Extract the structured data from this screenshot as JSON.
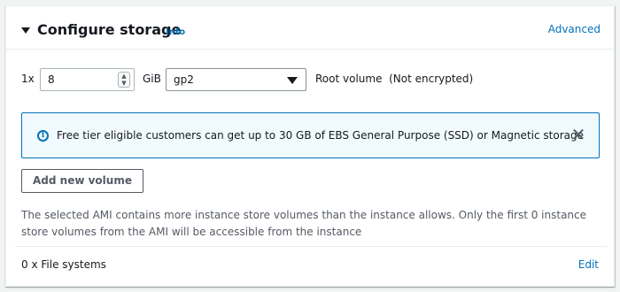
{
  "header": {
    "title": "Configure storage",
    "info_label": "Info",
    "advanced_label": "Advanced"
  },
  "volume": {
    "quantity_label": "1x",
    "size_value": "8",
    "size_unit": "GiB",
    "volume_type": "gp2",
    "root_label": "Root volume  (Not encrypted)"
  },
  "alert": {
    "icon": "info-icon",
    "text": "Free tier eligible customers can get up to 30 GB of EBS General Purpose (SSD) or Magnetic storage",
    "close_icon": "close-icon"
  },
  "actions": {
    "add_volume_label": "Add new volume"
  },
  "note": {
    "text": "The selected AMI contains more instance store volumes than the instance allows. Only the first 0 instance store volumes from the AMI will be accessible from the instance"
  },
  "file_systems": {
    "label": "0 x File systems",
    "edit_label": "Edit"
  },
  "colors": {
    "link": "#0073bb",
    "alert_bg": "#f1faff",
    "alert_border": "#0073bb",
    "text": "#16191f",
    "muted": "#545b64"
  }
}
